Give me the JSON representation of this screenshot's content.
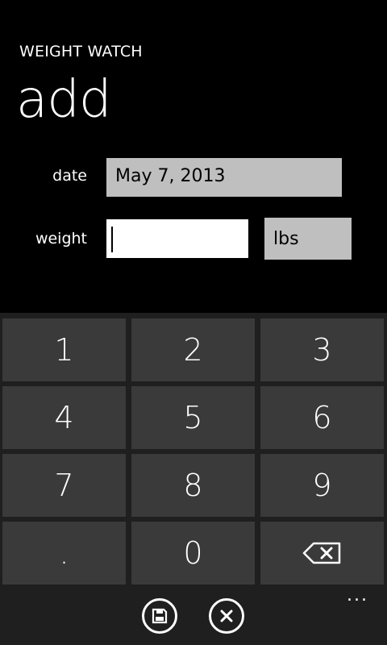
{
  "header": {
    "app_title": "WEIGHT WATCH",
    "page_title": "add"
  },
  "form": {
    "date_label": "date",
    "date_value": "May 7, 2013",
    "weight_label": "weight",
    "weight_value": "",
    "unit_value": "lbs"
  },
  "keypad": {
    "keys": [
      "1",
      "2",
      "3",
      "4",
      "5",
      "6",
      "7",
      "8",
      "9",
      ".",
      "0",
      "backspace"
    ]
  },
  "appbar": {
    "buttons": [
      "save-icon",
      "cancel-icon"
    ],
    "more_label": "..."
  }
}
